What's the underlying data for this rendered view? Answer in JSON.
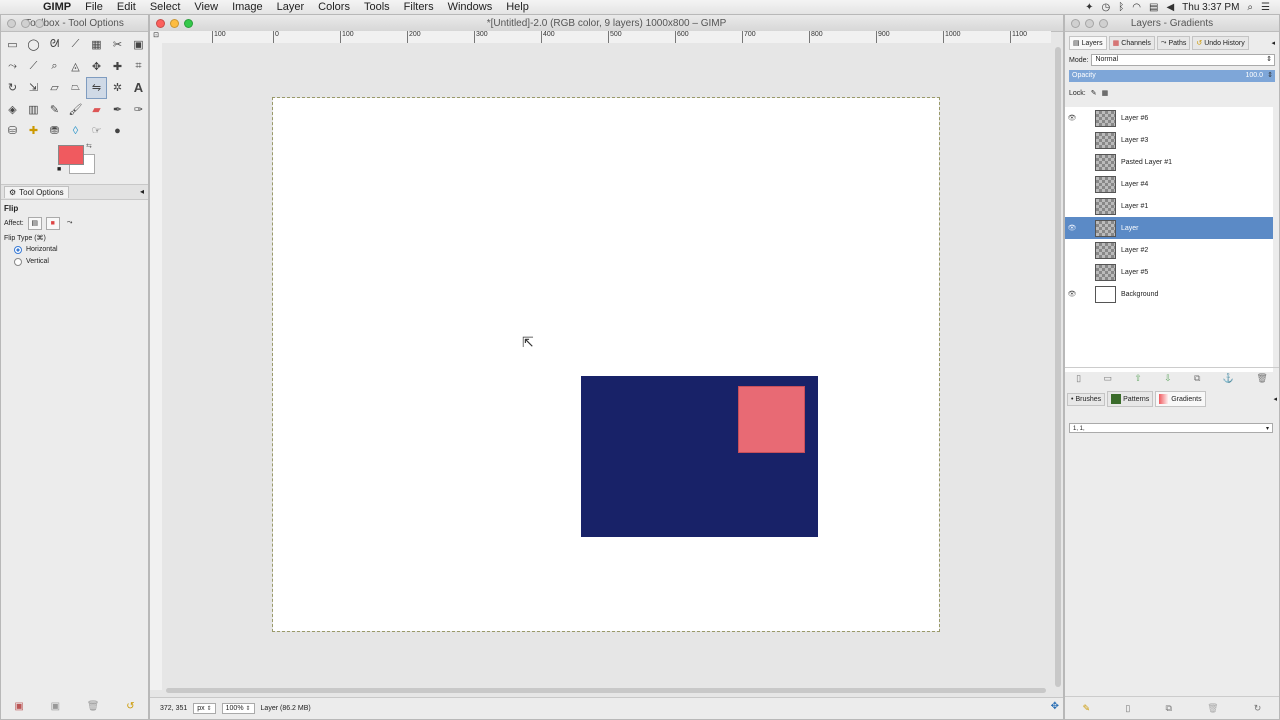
{
  "menubar": {
    "app": "GIMP",
    "menus": [
      "File",
      "Edit",
      "Select",
      "View",
      "Image",
      "Layer",
      "Colors",
      "Tools",
      "Filters",
      "Windows",
      "Help"
    ],
    "clock": "Thu 3:37 PM"
  },
  "toolbox": {
    "title": "Toolbox - Tool Options",
    "fg_color": "#f05a5f",
    "bg_color": "#ffffff",
    "tool_options_tab": "Tool Options",
    "tool_name": "Flip",
    "affect_label": "Affect:",
    "flip_type_label": "Flip Type  (⌘)",
    "options": [
      "Horizontal",
      "Vertical"
    ],
    "selected_option": "Horizontal"
  },
  "image_window": {
    "title": "*[Untitled]-2.0 (RGB color, 9 layers) 1000x800 – GIMP",
    "ruler_labels": [
      "100",
      "0",
      "100",
      "200",
      "300",
      "400",
      "500",
      "600",
      "700",
      "800",
      "900",
      "1000",
      "1100"
    ],
    "status": {
      "coords": "372, 351",
      "unit": "px",
      "zoom": "100%",
      "layer_info": "Layer (86.2 MB)"
    },
    "canvas": {
      "rect_color": "#182268",
      "square_color": "#e86a74"
    }
  },
  "layers_dock": {
    "title": "Layers - Gradients",
    "tabs": [
      "Layers",
      "Channels",
      "Paths",
      "Undo History"
    ],
    "mode_label": "Mode:",
    "mode_value": "Normal",
    "opacity_label": "Opacity",
    "opacity_value": "100.0",
    "lock_label": "Lock:",
    "layers": [
      {
        "name": "Layer #6",
        "visible": true
      },
      {
        "name": "Layer #3",
        "visible": false
      },
      {
        "name": "Pasted Layer #1",
        "visible": false
      },
      {
        "name": "Layer #4",
        "visible": false
      },
      {
        "name": "Layer #1",
        "visible": false
      },
      {
        "name": "Layer",
        "visible": true,
        "selected": true
      },
      {
        "name": "Layer #2",
        "visible": false
      },
      {
        "name": "Layer #5",
        "visible": false
      },
      {
        "name": "Background",
        "visible": true
      }
    ],
    "bottom_tabs": [
      "Brushes",
      "Patterns",
      "Gradients"
    ],
    "gradient_value": "1, 1,"
  }
}
